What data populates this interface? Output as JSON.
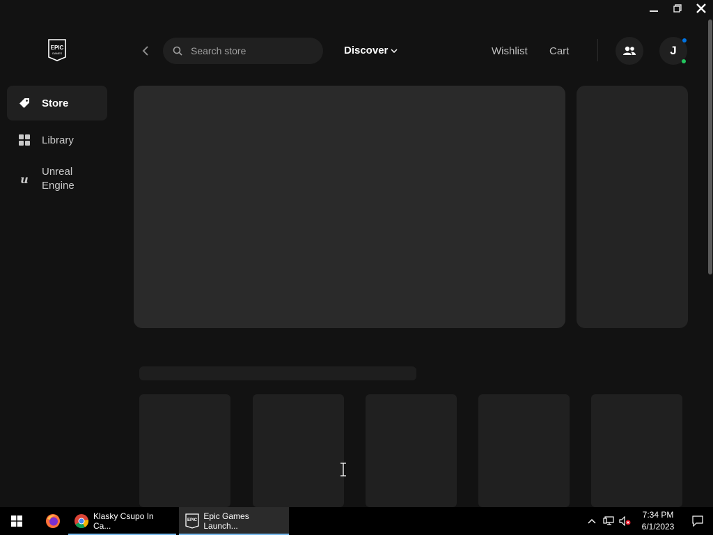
{
  "window": {
    "minimize_icon": "minimize-icon",
    "restore_icon": "restore-icon",
    "close_icon": "close-icon"
  },
  "sidebar": {
    "logo_text": "EPIC GAMES",
    "items": [
      {
        "label": "Store",
        "icon": "tag-icon",
        "active": true
      },
      {
        "label": "Library",
        "icon": "grid-icon",
        "active": false
      },
      {
        "label": "Unreal Engine",
        "icon": "unreal-icon",
        "active": false
      }
    ]
  },
  "header": {
    "search_placeholder": "Search store",
    "discover_label": "Discover",
    "wishlist_label": "Wishlist",
    "cart_label": "Cart",
    "avatar_initial": "J"
  },
  "colors": {
    "background": "#121212",
    "skeleton": "#2a2a2a",
    "status_online": "#22c55e",
    "notification_dot": "#0074e4"
  },
  "taskbar": {
    "tasks": [
      {
        "label": "Klasky Csupo In Ca...",
        "icon": "chrome-icon",
        "active": false
      },
      {
        "label": "Epic Games Launch...",
        "icon": "epic-icon",
        "active": true
      }
    ],
    "time": "7:34 PM",
    "date": "6/1/2023"
  }
}
